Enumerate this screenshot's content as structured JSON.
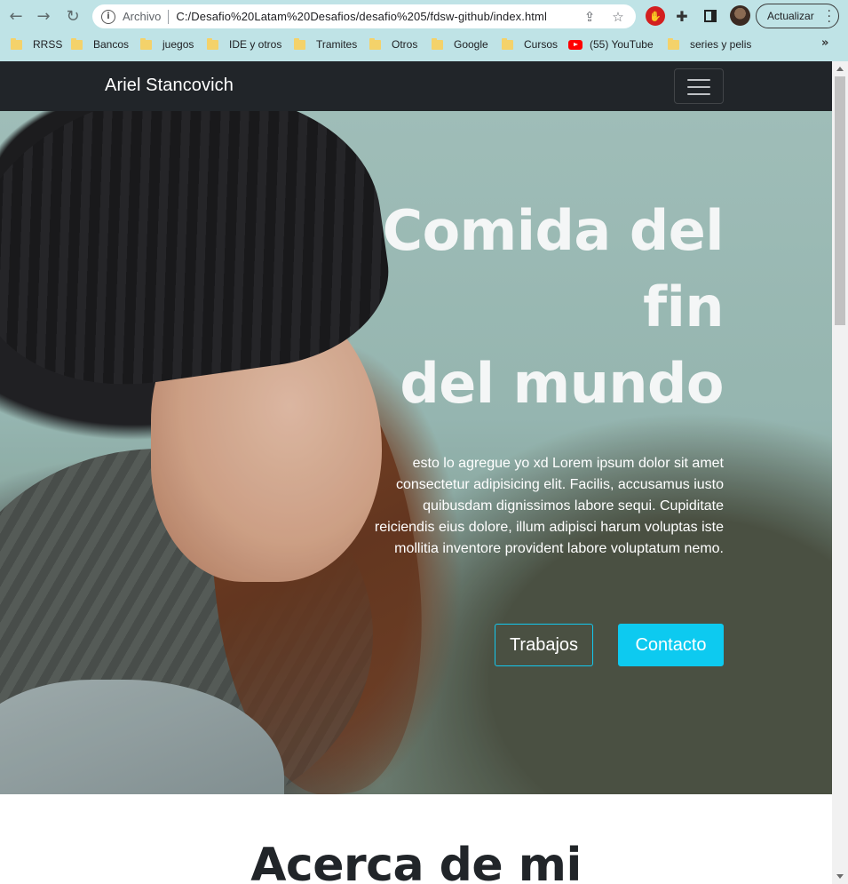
{
  "browser": {
    "omnibox": {
      "scheme_label": "Archivo",
      "url": "C:/Desafio%20Latam%20Desafios/desafio%205/fdsw-github/index.html"
    },
    "update_label": "Actualizar",
    "icons": {
      "back": "arrow-left-icon",
      "forward": "arrow-right-icon",
      "reload": "reload-icon",
      "info": "info-icon",
      "share": "share-icon",
      "star": "star-icon",
      "ext_block": "block-extension-icon",
      "extensions": "puzzle-icon",
      "sidepanel": "side-panel-icon",
      "more": "kebab-menu-icon"
    },
    "bookmarks": [
      {
        "label": "RRSS",
        "type": "folder"
      },
      {
        "label": "Bancos",
        "type": "folder"
      },
      {
        "label": "juegos",
        "type": "folder"
      },
      {
        "label": "IDE y otros",
        "type": "folder"
      },
      {
        "label": "Tramites",
        "type": "folder"
      },
      {
        "label": "Otros",
        "type": "folder"
      },
      {
        "label": "Google",
        "type": "folder"
      },
      {
        "label": "Cursos",
        "type": "folder"
      },
      {
        "label": "(55) YouTube",
        "type": "youtube"
      },
      {
        "label": "series y pelis",
        "type": "folder"
      }
    ],
    "bookmarks_more": "»"
  },
  "page": {
    "navbar": {
      "brand": "Ariel Stancovich"
    },
    "hero": {
      "title_lines": [
        "Comida del",
        "fin",
        "del mundo"
      ],
      "text": "esto lo agregue yo xd Lorem ipsum dolor sit amet consectetur adipisicing elit. Facilis, accusamus iusto quibusdam dignissimos labore sequi. Cupiditate reiciendis eius dolore, illum adipisci harum voluptas iste mollitia inventore provident labore voluptatum nemo.",
      "buttons": {
        "works": "Trabajos",
        "contact": "Contacto"
      },
      "accent_color": "#0dcaf0"
    },
    "about": {
      "title": "Acerca de mi"
    }
  }
}
